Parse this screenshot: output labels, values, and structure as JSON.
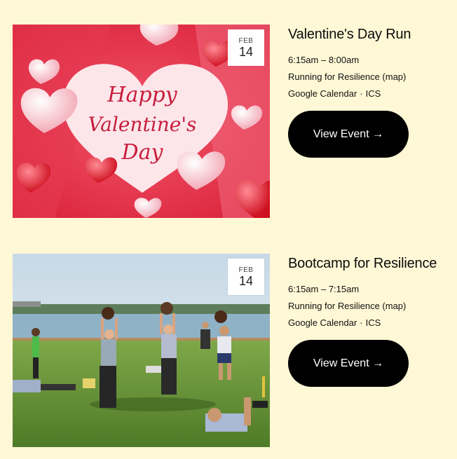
{
  "events": [
    {
      "month": "FEB",
      "day": "14",
      "title": "Valentine's Day Run",
      "time": "6:15am – 8:00am",
      "location": "Running for Resilience",
      "map_label": "(map)",
      "calendar_google": "Google Calendar",
      "separator": "·",
      "calendar_ics": "ICS",
      "button_label": "View Event →",
      "image_text": [
        "Happy",
        "Valentine's",
        "Day"
      ]
    },
    {
      "month": "FEB",
      "day": "14",
      "title": "Bootcamp for Resilience",
      "time": "6:15am – 7:15am",
      "location": "Running for Resilience",
      "map_label": "(map)",
      "calendar_google": "Google Calendar",
      "separator": "·",
      "calendar_ics": "ICS",
      "button_label": "View Event →"
    }
  ],
  "colors": {
    "page_background": "#fff8d6",
    "button_background": "#000000",
    "button_text": "#ffffff"
  }
}
